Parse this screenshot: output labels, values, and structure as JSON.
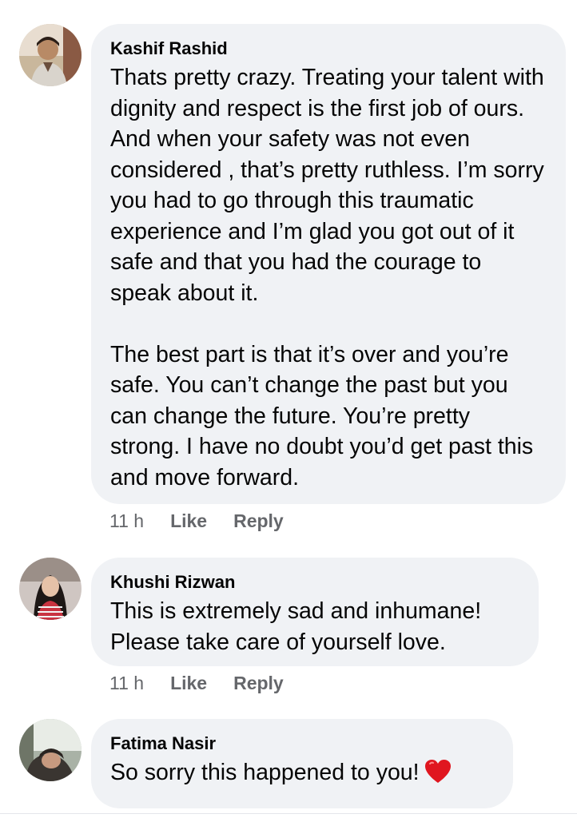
{
  "comments": [
    {
      "author": "Kashif Rashid",
      "text": "Thats pretty crazy. Treating your talent with dignity and respect is the first job of ours. And when your safety was not even considered , that’s pretty ruthless. I’m sorry you had to go through this traumatic experience and I’m glad you got out of it safe and that you had the courage to speak about it.\n\nThe best part is that it’s over and you’re safe. You can’t change the past but you can change the future. You’re pretty strong. I have no doubt you’d get past this and move forward.",
      "time": "11 h",
      "like_label": "Like",
      "reply_label": "Reply"
    },
    {
      "author": "Khushi Rizwan",
      "text": "This is extremely sad and inhumane!\nPlease take care of yourself love.",
      "time": "11 h",
      "like_label": "Like",
      "reply_label": "Reply"
    },
    {
      "author": "Fatima Nasir",
      "text": "So sorry this happened to you!",
      "emoji": "heart-icon"
    }
  ],
  "colors": {
    "bubble": "#f0f2f5",
    "text": "#050505",
    "meta": "#65676b",
    "heart": "#e0161f"
  }
}
